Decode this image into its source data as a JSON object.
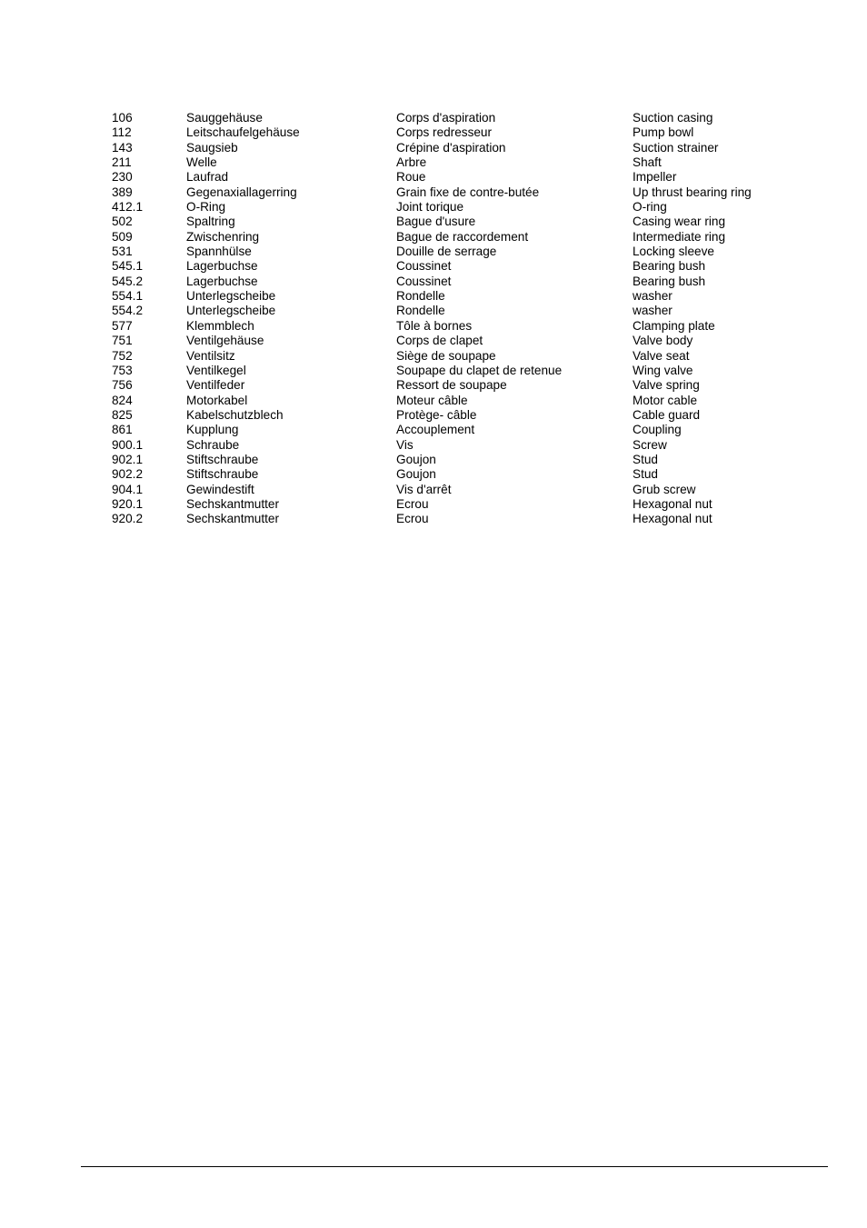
{
  "parts_list": {
    "rows": [
      {
        "no": "106",
        "de": "Sauggehäuse",
        "fr": "Corps d'aspiration",
        "en": "Suction casing"
      },
      {
        "no": "112",
        "de": "Leitschaufelgehäuse",
        "fr": "Corps redresseur",
        "en": "Pump bowl"
      },
      {
        "no": "143",
        "de": "Saugsieb",
        "fr": "Crépine d'aspiration",
        "en": "Suction strainer"
      },
      {
        "no": "211",
        "de": "Welle",
        "fr": "Arbre",
        "en": "Shaft"
      },
      {
        "no": "230",
        "de": "Laufrad",
        "fr": "Roue",
        "en": "Impeller"
      },
      {
        "no": "389",
        "de": "Gegenaxiallagerring",
        "fr": "Grain fixe de contre-butée",
        "en": "Up thrust bearing ring"
      },
      {
        "no": "412.1",
        "de": "O-Ring",
        "fr": "Joint torique",
        "en": "O-ring"
      },
      {
        "no": "502",
        "de": "Spaltring",
        "fr": "Bague d'usure",
        "en": "Casing wear ring"
      },
      {
        "no": "509",
        "de": "Zwischenring",
        "fr": "Bague de raccordement",
        "en": "Intermediate ring"
      },
      {
        "no": "531",
        "de": "Spannhülse",
        "fr": "Douille de serrage",
        "en": "Locking sleeve"
      },
      {
        "no": "545.1",
        "de": "Lagerbuchse",
        "fr": "Coussinet",
        "en": "Bearing bush"
      },
      {
        "no": "545.2",
        "de": "Lagerbuchse",
        "fr": "Coussinet",
        "en": "Bearing bush"
      },
      {
        "no": "554.1",
        "de": "Unterlegscheibe",
        "fr": "Rondelle",
        "en": "washer"
      },
      {
        "no": "554.2",
        "de": "Unterlegscheibe",
        "fr": "Rondelle",
        "en": "washer"
      },
      {
        "no": "577",
        "de": "Klemmblech",
        "fr": "Tôle à bornes",
        "en": "Clamping plate"
      },
      {
        "no": "751",
        "de": "Ventilgehäuse",
        "fr": "Corps de clapet",
        "en": "Valve body"
      },
      {
        "no": "752",
        "de": "Ventilsitz",
        "fr": "Siège de soupape",
        "en": "Valve seat"
      },
      {
        "no": "753",
        "de": "Ventilkegel",
        "fr": "Soupape du clapet de retenue",
        "en": "Wing valve"
      },
      {
        "no": "756",
        "de": "Ventilfeder",
        "fr": "Ressort de soupape",
        "en": "Valve spring"
      },
      {
        "no": "824",
        "de": "Motorkabel",
        "fr": "Moteur câble",
        "en": "Motor cable"
      },
      {
        "no": "825",
        "de": "Kabelschutzblech",
        "fr": "Protège- câble",
        "en": "Cable guard"
      },
      {
        "no": "861",
        "de": "Kupplung",
        "fr": "Accouplement",
        "en": "Coupling"
      },
      {
        "no": "900.1",
        "de": "Schraube",
        "fr": "Vis",
        "en": "Screw"
      },
      {
        "no": "902.1",
        "de": "Stiftschraube",
        "fr": "Goujon",
        "en": "Stud"
      },
      {
        "no": "902.2",
        "de": "Stiftschraube",
        "fr": "Goujon",
        "en": "Stud"
      },
      {
        "no": "904.1",
        "de": "Gewindestift",
        "fr": "Vis d'arrêt",
        "en": "Grub screw"
      },
      {
        "no": "920.1",
        "de": "Sechskantmutter",
        "fr": "Ecrou",
        "en": "Hexagonal nut"
      },
      {
        "no": "920.2",
        "de": "Sechskantmutter",
        "fr": "Ecrou",
        "en": "Hexagonal nut"
      }
    ]
  }
}
